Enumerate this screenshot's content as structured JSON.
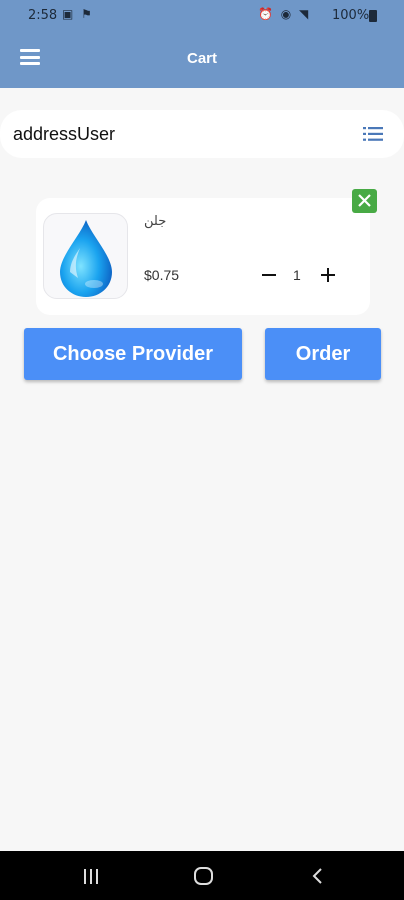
{
  "status_bar": {
    "time": "2:58",
    "left_icons": "▣ ⚑",
    "right_icons": "⏰ ◉ ◥",
    "battery": "100%"
  },
  "app_bar": {
    "title": "Cart",
    "menu_icon": "hamburger-menu-icon",
    "background": "#6f97c8"
  },
  "address": {
    "label": "addressUser",
    "icon": "list-icon"
  },
  "cart_items": [
    {
      "name": "جلن",
      "price": "$0.75",
      "quantity": "1",
      "image_icon": "water-drop-icon",
      "remove_icon": "close-icon",
      "remove_color": "#48aa45"
    }
  ],
  "actions": {
    "choose_provider": "Choose Provider",
    "order": "Order",
    "button_color": "#4b8ff7"
  },
  "nav_bar": {
    "recent_icon": "recent-apps-icon",
    "home_icon": "home-icon",
    "back_icon": "back-icon"
  }
}
